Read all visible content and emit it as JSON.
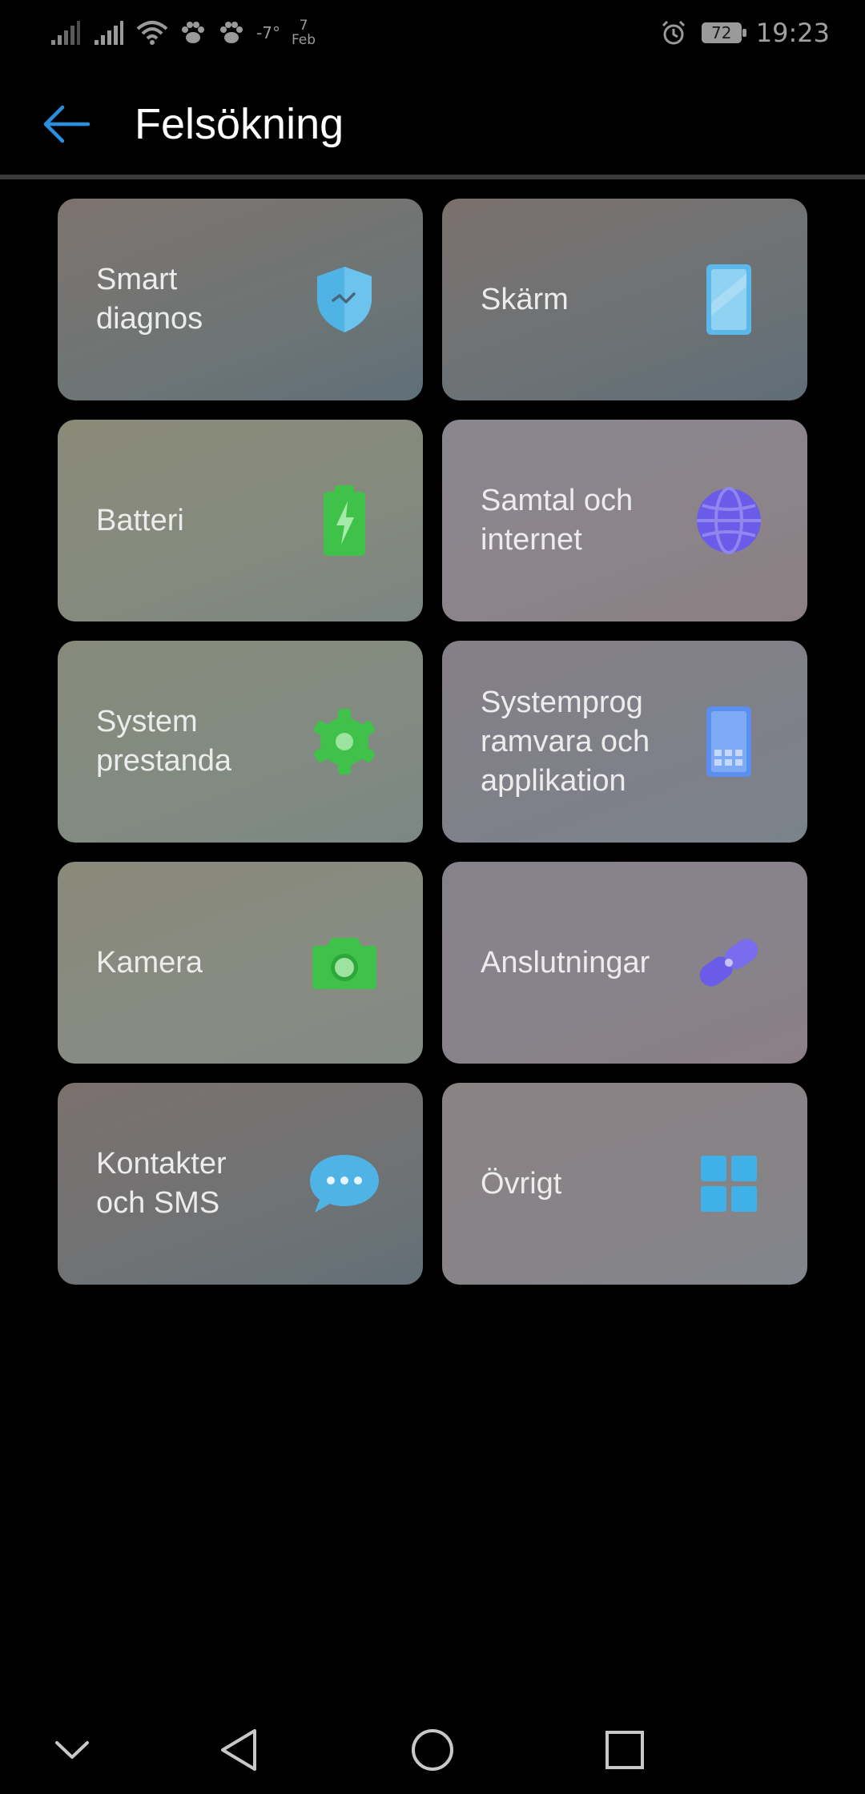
{
  "status_bar": {
    "temperature": "-7°",
    "date_day": "7",
    "date_month": "Feb",
    "battery": "72",
    "time": "19:23"
  },
  "app_bar": {
    "title": "Felsökning"
  },
  "tiles": [
    {
      "label": "Smart\ndiagnos",
      "icon": "shield-icon",
      "color": "#4fb3e6"
    },
    {
      "label": "Skärm",
      "icon": "phone-screen-icon",
      "color": "#5cb8e8"
    },
    {
      "label": "Batteri",
      "icon": "battery-icon",
      "color": "#3fc14a"
    },
    {
      "label": "Samtal och\ninternet",
      "icon": "globe-icon",
      "color": "#6a5be8"
    },
    {
      "label": "System\nprestanda",
      "icon": "gear-icon",
      "color": "#3fc14a"
    },
    {
      "label": "Systemprog\nramvara och\napplikation",
      "icon": "phone-apps-icon",
      "color": "#5b8fef"
    },
    {
      "label": "Kamera",
      "icon": "camera-icon",
      "color": "#3fc14a"
    },
    {
      "label": "Anslutningar",
      "icon": "link-icon",
      "color": "#6a5be8"
    },
    {
      "label": "Kontakter\noch SMS",
      "icon": "chat-bubble-icon",
      "color": "#4fb3e6"
    },
    {
      "label": "Övrigt",
      "icon": "grid-icon",
      "color": "#3fb0e8"
    }
  ]
}
